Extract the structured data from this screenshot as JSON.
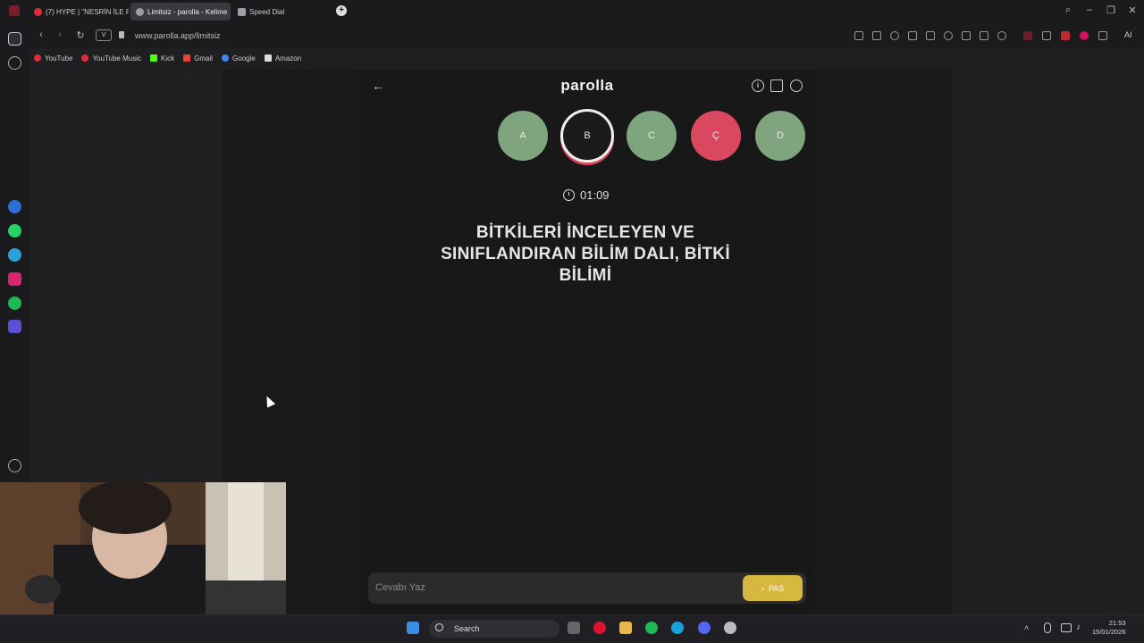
{
  "browser": {
    "tabs": [
      {
        "label": "(7) HYPE | \"NESRİN İLE PA",
        "color": "#e02b3b"
      },
      {
        "label": "Limitsiz - parolla - Kelime",
        "color": "#9aa0a6",
        "active": true
      },
      {
        "label": "Speed Dial",
        "color": "#9aa0a6"
      }
    ],
    "url": "www.parolla.app/limitsiz",
    "vpn_badge": "V",
    "bookmarks": [
      {
        "label": "YouTube",
        "color": "#e02b3b"
      },
      {
        "label": "YouTube Music",
        "color": "#e02b3b"
      },
      {
        "label": "Kick",
        "color": "#53fc18"
      },
      {
        "label": "Gmail",
        "color": "#ea4335"
      },
      {
        "label": "Google",
        "color": "#4285f4"
      },
      {
        "label": "Amazon",
        "color": "#dddddd"
      }
    ],
    "ai_label": "AI"
  },
  "game": {
    "logo": "parolla",
    "letters": [
      {
        "char": "A",
        "state": "correct",
        "color": "#7fa57e"
      },
      {
        "char": "B",
        "state": "current",
        "color": "#1b1b1b"
      },
      {
        "char": "C",
        "state": "correct",
        "color": "#7fa57e"
      },
      {
        "char": "Ç",
        "state": "wrong",
        "color": "#d9485f"
      },
      {
        "char": "D",
        "state": "correct",
        "color": "#7fa57e"
      }
    ],
    "timer": "01:09",
    "question": "BİTKİLERİ İNCELEYEN VE SINIFLANDIRAN BİLİM DALI, BİTKİ BİLİMİ",
    "answer_placeholder": "Cevabı Yaz",
    "pass_label": "PAS",
    "pass_color": "#d6b740"
  },
  "taskbar": {
    "search_label": "Search",
    "time": "21:53",
    "date": "15/01/2026"
  }
}
